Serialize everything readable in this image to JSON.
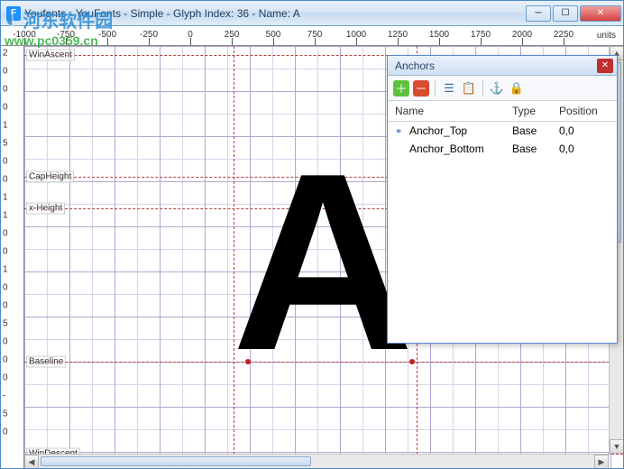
{
  "window": {
    "title": "Youfonts - YouFonts - Simple - Glyph Index: 36 - Name: A",
    "icon_letter": "F"
  },
  "ruler": {
    "h_labels": [
      "-1000",
      "-750",
      "-500",
      "-250",
      "0",
      "250",
      "500",
      "750",
      "1000",
      "1250",
      "1500",
      "1750",
      "2000",
      "2250"
    ],
    "units": "units",
    "v_labels": [
      "2",
      "0",
      "0",
      "0",
      "1",
      "5",
      "0",
      "0",
      "1",
      "1",
      "0",
      "0",
      "1",
      "0",
      "0",
      "5",
      "0",
      "0",
      "0",
      "-",
      "5",
      "0"
    ]
  },
  "guides": {
    "win_ascent": "WinAscent",
    "cap_height": "CapHeight",
    "x_height": "x-Height",
    "baseline": "Baseline",
    "win_descent": "WinDescent"
  },
  "glyph": {
    "letter": "A"
  },
  "panel": {
    "title": "Anchors",
    "columns": {
      "name": "Name",
      "type": "Type",
      "position": "Position"
    },
    "rows": [
      {
        "name": "Anchor_Top",
        "type": "Base",
        "position": "0,0",
        "linked": true
      },
      {
        "name": "Anchor_Bottom",
        "type": "Base",
        "position": "0,0",
        "linked": false
      }
    ]
  },
  "watermark": {
    "cn": "河东软件园",
    "url": "www.pc0359.cn"
  }
}
